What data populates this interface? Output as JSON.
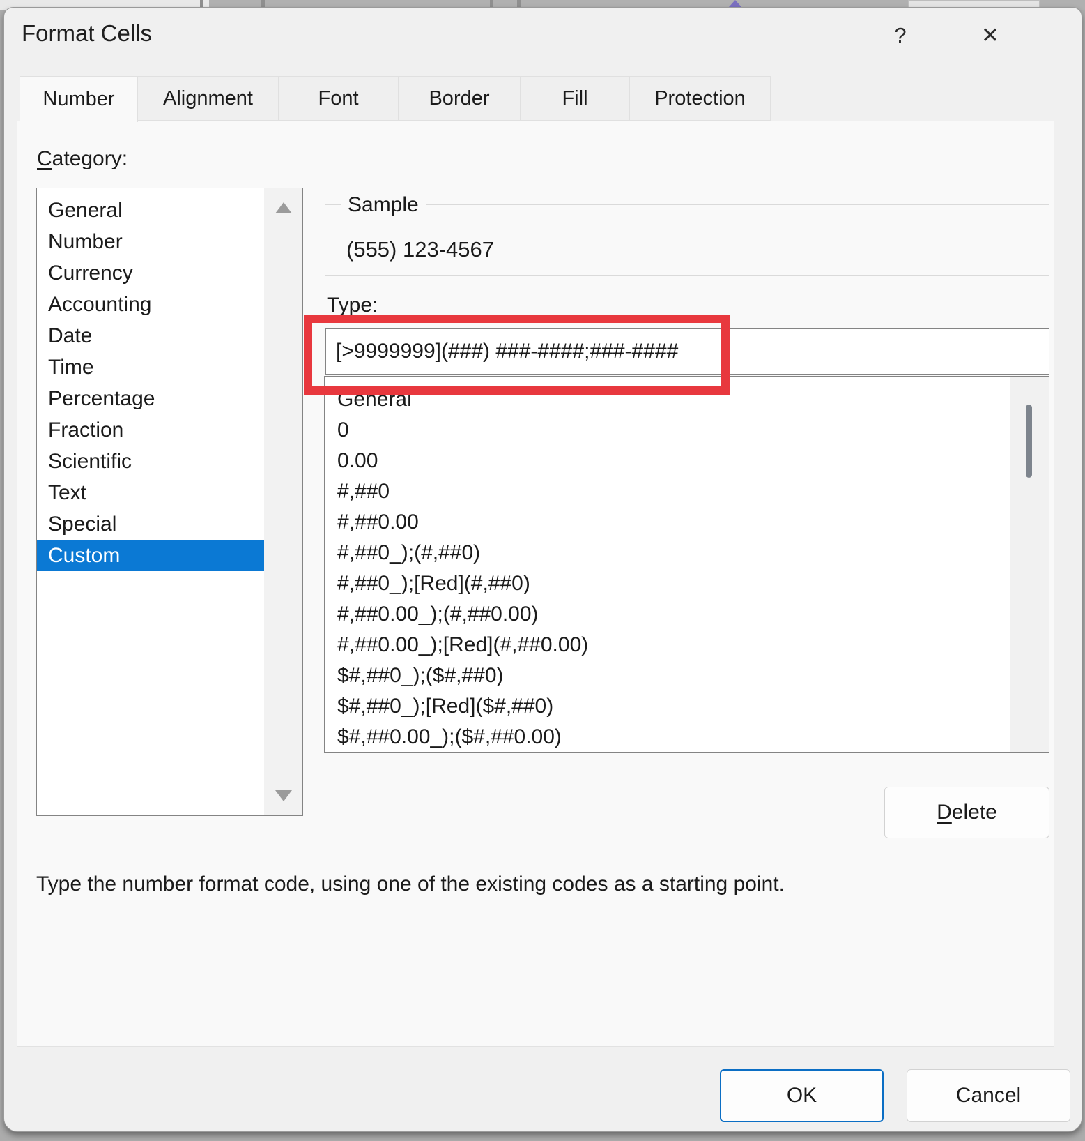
{
  "dialog": {
    "title": "Format Cells",
    "titlebar": {
      "help_label": "?",
      "close_label": "✕"
    },
    "tabs": [
      {
        "label": "Number",
        "selected": true
      },
      {
        "label": "Alignment"
      },
      {
        "label": "Font"
      },
      {
        "label": "Border"
      },
      {
        "label": "Fill"
      },
      {
        "label": "Protection"
      }
    ],
    "category": {
      "label_mnemonic": "C",
      "label_rest": "ategory:",
      "items": [
        {
          "label": "General"
        },
        {
          "label": "Number"
        },
        {
          "label": "Currency"
        },
        {
          "label": "Accounting"
        },
        {
          "label": "Date"
        },
        {
          "label": "Time"
        },
        {
          "label": "Percentage"
        },
        {
          "label": "Fraction"
        },
        {
          "label": "Scientific"
        },
        {
          "label": "Text"
        },
        {
          "label": "Special"
        },
        {
          "label": "Custom",
          "selected": true
        }
      ]
    },
    "sample": {
      "label": "Sample",
      "value": "(555) 123-4567"
    },
    "type": {
      "label": "Type:",
      "value": "[>9999999](###) ###-####;###-####"
    },
    "format_codes": [
      "General",
      "0",
      "0.00",
      "#,##0",
      "#,##0.00",
      "#,##0_);(#,##0)",
      "#,##0_);[Red](#,##0)",
      "#,##0.00_);(#,##0.00)",
      "#,##0.00_);[Red](#,##0.00)",
      "$#,##0_);($#,##0)",
      "$#,##0_);[Red]($#,##0)",
      "$#,##0.00_);($#,##0.00)"
    ],
    "buttons": {
      "delete_mnemonic": "D",
      "delete_rest": "elete",
      "ok": "OK",
      "cancel": "Cancel"
    },
    "description": "Type the number format code, using one of the existing codes as a starting point.",
    "colors": {
      "accent": "#0b79d4",
      "annotation": "#e8383e"
    }
  }
}
